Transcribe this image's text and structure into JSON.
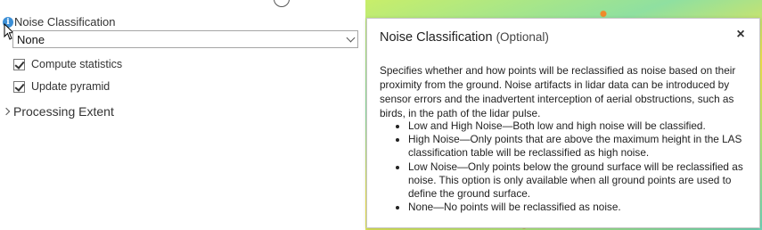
{
  "parameter": {
    "label": "Noise Classification",
    "dropdown_value": "None"
  },
  "options": [
    {
      "label": "Compute statistics",
      "checked": true
    },
    {
      "label": "Update pyramid",
      "checked": true
    }
  ],
  "section": {
    "label": "Processing Extent"
  },
  "help_popup": {
    "title": "Noise Classification",
    "optional": "(Optional)",
    "close_symbol": "×",
    "description": "Specifies whether and how points will be reclassified as noise based on their proximity from the ground. Noise artifacts in lidar data can be introduced by sensor errors and the inadvertent interception of aerial obstructions, such as birds, in the path of the lidar pulse.",
    "bullets": [
      "Low and High Noise—Both low and high noise will be classified.",
      "High Noise—Only points that are above the maximum height in the LAS classification table will be reclassified as high noise.",
      "Low Noise—Only points below the ground surface will be reclassified as noise. This option is only available when all ground points are used to define the ground surface.",
      "None—No points will be reclassified as noise."
    ]
  },
  "icons": {
    "info": "info-icon",
    "cursor": "cursor-icon",
    "dropdown": "chevron-down-icon",
    "expander": "chevron-right-icon",
    "close": "close-icon"
  },
  "colors": {
    "info_icon": "#3c8fd6",
    "border": "#a6a6a6"
  }
}
